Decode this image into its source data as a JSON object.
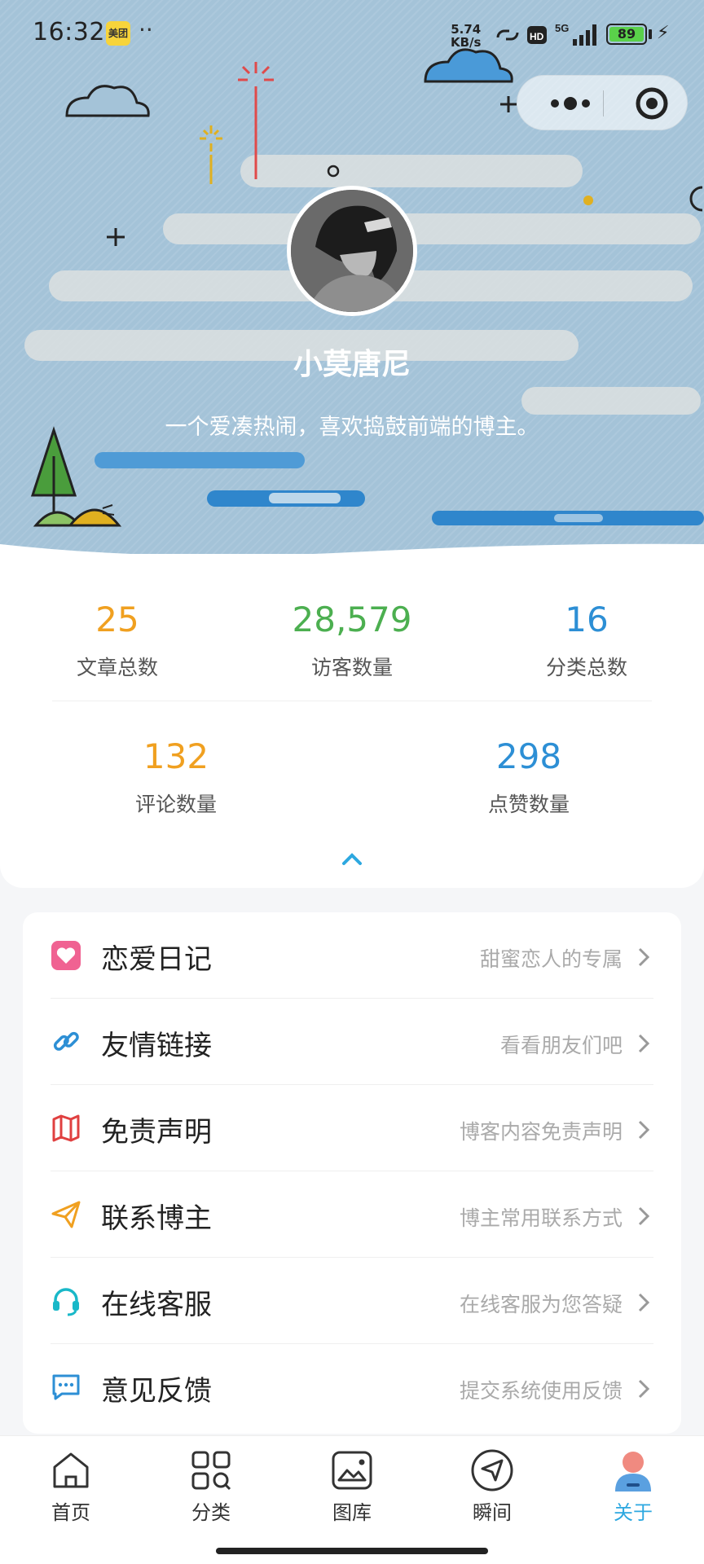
{
  "status_bar": {
    "time": "16:32",
    "meituan_label": "美团",
    "dots": "··",
    "net_speed_value": "5.74",
    "net_speed_unit": "KB/s",
    "hd_label": "HD",
    "network_label": "5G",
    "battery": "89"
  },
  "capsule": {
    "more_icon": "more-dots-icon",
    "close_icon": "target-circle-icon"
  },
  "profile": {
    "name": "小莫唐尼",
    "motto": "一个爱凑热闹，喜欢捣鼓前端的博主。"
  },
  "stats": [
    {
      "value": "25",
      "label": "文章总数",
      "color": "#f0a020"
    },
    {
      "value": "28,579",
      "label": "访客数量",
      "color": "#4caf50"
    },
    {
      "value": "16",
      "label": "分类总数",
      "color": "#2d8fd5"
    },
    {
      "value": "132",
      "label": "评论数量",
      "color": "#f0a020"
    },
    {
      "value": "298",
      "label": "点赞数量",
      "color": "#2d8fd5"
    }
  ],
  "menu": [
    {
      "title": "恋爱日记",
      "desc": "甜蜜恋人的专属",
      "icon": "heart-icon",
      "color": "#f06292"
    },
    {
      "title": "友情链接",
      "desc": "看看朋友们吧",
      "icon": "link-icon",
      "color": "#2d8fd5"
    },
    {
      "title": "免责声明",
      "desc": "博客内容免责声明",
      "icon": "map-book-icon",
      "color": "#e04040"
    },
    {
      "title": "联系博主",
      "desc": "博主常用联系方式",
      "icon": "paper-plane-icon",
      "color": "#f0a020"
    },
    {
      "title": "在线客服",
      "desc": "在线客服为您答疑",
      "icon": "headset-icon",
      "color": "#19b8c8"
    },
    {
      "title": "意见反馈",
      "desc": "提交系统使用反馈",
      "icon": "chat-bubble-icon",
      "color": "#2d8fd5"
    }
  ],
  "tabs": [
    {
      "label": "首页",
      "icon": "home-icon",
      "active": false
    },
    {
      "label": "分类",
      "icon": "grid-icon",
      "active": false
    },
    {
      "label": "图库",
      "icon": "gallery-icon",
      "active": false
    },
    {
      "label": "瞬间",
      "icon": "compass-send-icon",
      "active": false
    },
    {
      "label": "关于",
      "icon": "user-avatar-icon",
      "active": true
    }
  ],
  "accent_color": "#2da8e0"
}
